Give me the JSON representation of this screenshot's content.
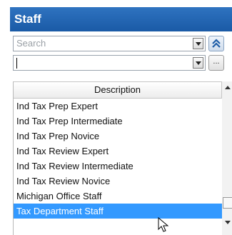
{
  "panel": {
    "title": "Staff"
  },
  "search": {
    "placeholder": "Search",
    "value": ""
  },
  "combo": {
    "value": ""
  },
  "buttons": {
    "ellipsis_label": "..."
  },
  "list": {
    "header": "Description",
    "items": [
      "Ind Tax Prep Expert",
      "Ind Tax Prep Intermediate",
      "Ind Tax Prep Novice",
      "Ind Tax Review Expert",
      "Ind Tax Review Intermediate",
      "Ind Tax Review Novice",
      "Michigan Office Staff",
      "Tax Department Staff"
    ],
    "selected_index": 7
  },
  "colors": {
    "title_bar": "#1f64b4",
    "selection": "#3399ff"
  },
  "icons": {
    "collapse": "double-chevron-up-icon",
    "dropdown": "chevron-down-icon",
    "cursor": "mouse-pointer-icon"
  }
}
